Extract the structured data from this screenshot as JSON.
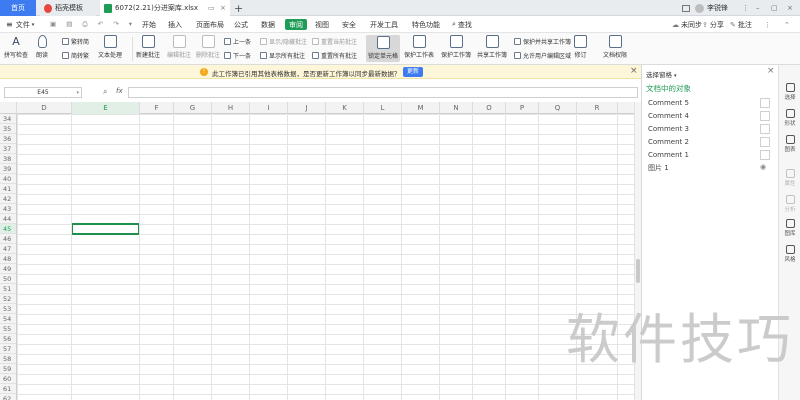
{
  "titlebar": {
    "home_tab": "首页",
    "template_tab": "稻壳模板",
    "file_tab": "6072(2.21)分进案库.xlsx",
    "add_tab": "+",
    "user": "李锐锋",
    "badge": "1"
  },
  "menubar": {
    "file_menu": "文件",
    "items": [
      "开始",
      "插入",
      "页面布局",
      "公式",
      "数据",
      "审阅",
      "视图",
      "安全",
      "开发工具",
      "特色功能"
    ],
    "search": "查找",
    "sync": "未同步",
    "share": "分享",
    "comment": "批注"
  },
  "ribbon": {
    "spellcheck": "拼写检查",
    "read_aloud": "朗读",
    "trad_to_simp": "繁转简",
    "simp_to_trad": "简转繁",
    "text_processing": "文本处理",
    "new_comment": "新建批注",
    "edit_comment": "编辑批注",
    "delete_comment": "删除批注",
    "prev": "上一条",
    "next": "下一条",
    "show_hide_comment": "显示/隐藏批注",
    "show_all_comments": "显示所有批注",
    "reset_current_comment": "重置当前批注",
    "reset_all_comments": "重置所有批注",
    "lock_cell": "锁定单元格",
    "protect_sheet": "保护工作表",
    "protect_workbook": "保护工作簿",
    "share_workbook": "共享工作簿",
    "protect_share_workbook": "保护并共享工作簿",
    "allow_edit_ranges": "允许用户编辑区域",
    "track_changes": "修订",
    "doc_permissions": "文档权限"
  },
  "notice": {
    "text": "此工作簿已引用其他表格数据，是否更新工作簿以同步最新数据？",
    "button": "更新"
  },
  "formulabar": {
    "namebox": "E45",
    "fx": "fx"
  },
  "grid": {
    "columns": [
      "D",
      "E",
      "F",
      "G",
      "H",
      "I",
      "J",
      "K",
      "L",
      "M",
      "N",
      "O",
      "P",
      "Q",
      "R"
    ],
    "rows": [
      "34",
      "35",
      "36",
      "37",
      "38",
      "39",
      "40",
      "41",
      "42",
      "43",
      "44",
      "45",
      "46",
      "47",
      "48",
      "49",
      "50",
      "51",
      "52",
      "53",
      "54",
      "55",
      "56",
      "57",
      "58",
      "59",
      "60",
      "61",
      "62"
    ],
    "active_row": "45",
    "active_col": "E"
  },
  "pane": {
    "header": "选择窗格",
    "section_title": "文档中的对象",
    "items": [
      "Comment 5",
      "Comment 4",
      "Comment 3",
      "Comment 2",
      "Comment 1",
      "图片 1"
    ]
  },
  "rstrip": {
    "items": [
      "选择",
      "形状",
      "图表",
      "属性",
      "分析",
      "图库",
      "风格"
    ]
  },
  "watermark": "软件技巧",
  "colors": {
    "accent": "#1f9c56",
    "home_tab": "#3e7bf0",
    "notice_bg": "#fdf6d8"
  }
}
